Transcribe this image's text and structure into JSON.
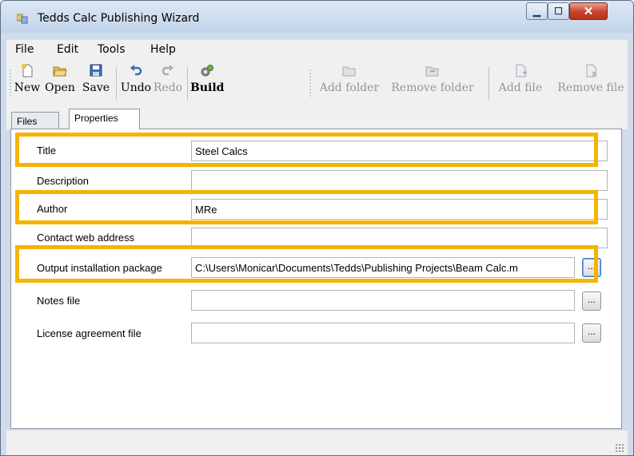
{
  "window": {
    "title": "Tedds Calc Publishing Wizard",
    "minimize_glyph": "▁",
    "maximize_glyph": "☐",
    "close_glyph": "✕"
  },
  "menu": {
    "items": [
      "File",
      "Edit",
      "Tools",
      "Help"
    ]
  },
  "toolbar": {
    "buttons": [
      {
        "label": "New",
        "icon": "new-file-icon"
      },
      {
        "label": "Open",
        "icon": "open-folder-icon"
      },
      {
        "label": "Save",
        "icon": "save-disk-icon"
      },
      {
        "label": "Undo",
        "icon": "undo-icon"
      },
      {
        "label": "Redo",
        "icon": "redo-icon",
        "disabled": true
      },
      {
        "label": "Build",
        "icon": "build-gears-icon"
      },
      {
        "label": "Add folder",
        "icon": "add-folder-icon",
        "disabled": true
      },
      {
        "label": "Remove folder",
        "icon": "remove-folder-icon",
        "disabled": true
      },
      {
        "label": "Add file",
        "icon": "add-file-icon",
        "disabled": true
      },
      {
        "label": "Remove file",
        "icon": "remove-file-icon",
        "disabled": true
      }
    ]
  },
  "tabs": [
    {
      "label": "Files",
      "active": false
    },
    {
      "label": "Properties",
      "active": true
    }
  ],
  "properties": [
    {
      "label": "Title",
      "value": "Steel Calcs",
      "highlighted": true
    },
    {
      "label": "Description",
      "value": ""
    },
    {
      "label": "Author",
      "value": "MRe",
      "highlighted": true
    },
    {
      "label": "Contact web address",
      "value": ""
    },
    {
      "label": "Output installation package",
      "value": "C:\\Users\\Monicar\\Documents\\Tedds\\Publishing Projects\\Beam Calc.m",
      "browse_label": "...",
      "highlighted": true
    },
    {
      "label": "Notes file",
      "value": "",
      "browse_label": "..."
    },
    {
      "label": "License agreement file",
      "value": "",
      "browse_label": "..."
    }
  ],
  "colors": {
    "highlight": "#f5b400",
    "accent": "#3b7fd0"
  }
}
